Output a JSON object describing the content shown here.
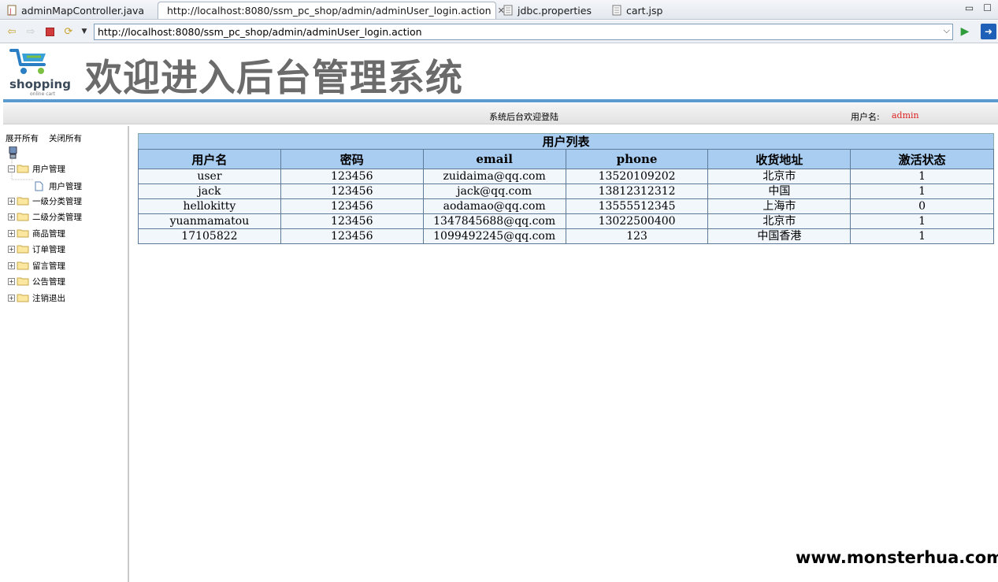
{
  "editor_tabs": [
    {
      "label": "adminMapController.java",
      "icon": "java-file-icon"
    },
    {
      "label": "http://localhost:8080/ssm_pc_shop/admin/adminUser_login.action",
      "icon": "globe-icon",
      "active": true
    },
    {
      "label": "jdbc.properties",
      "icon": "properties-file-icon"
    },
    {
      "label": "cart.jsp",
      "icon": "jsp-file-icon"
    }
  ],
  "browser": {
    "url": "http://localhost:8080/ssm_pc_shop/admin/adminUser_login.action"
  },
  "header": {
    "logo_text": "shopping",
    "logo_subtext": "online cart",
    "title": "欢迎进入后台管理系统",
    "welcome": "系统后台欢迎登陆",
    "user_label": "用户名:",
    "user_name": "admin"
  },
  "tree": {
    "expand_all": "展开所有",
    "collapse_all": "关闭所有",
    "items": [
      {
        "label": "用户管理",
        "expanded": true,
        "children": [
          {
            "label": "用户管理"
          }
        ]
      },
      {
        "label": "一级分类管理"
      },
      {
        "label": "二级分类管理"
      },
      {
        "label": "商品管理"
      },
      {
        "label": "订单管理"
      },
      {
        "label": "留言管理"
      },
      {
        "label": "公告管理"
      },
      {
        "label": "注销退出"
      }
    ]
  },
  "table": {
    "caption": "用户列表",
    "columns": [
      "用户名",
      "密码",
      "email",
      "phone",
      "收货地址",
      "激活状态"
    ],
    "rows": [
      [
        "user",
        "123456",
        "zuidaima@qq.com",
        "13520109202",
        "北京市",
        "1"
      ],
      [
        "jack",
        "123456",
        "jack@qq.com",
        "13812312312",
        "中国",
        "1"
      ],
      [
        "hellokitty",
        "123456",
        "aodamao@qq.com",
        "13555512345",
        "上海市",
        "0"
      ],
      [
        "yuanmamatou",
        "123456",
        "1347845688@qq.com",
        "13022500400",
        "北京市",
        "1"
      ],
      [
        "17105822",
        "123456",
        "1099492245@qq.com",
        "123",
        "中国香港",
        "1"
      ]
    ]
  },
  "watermark": "www.monsterhua.com",
  "colors": {
    "accent_blue": "#5b9bd0",
    "table_header": "#a9cdf1",
    "user_name": "#dd2222"
  }
}
